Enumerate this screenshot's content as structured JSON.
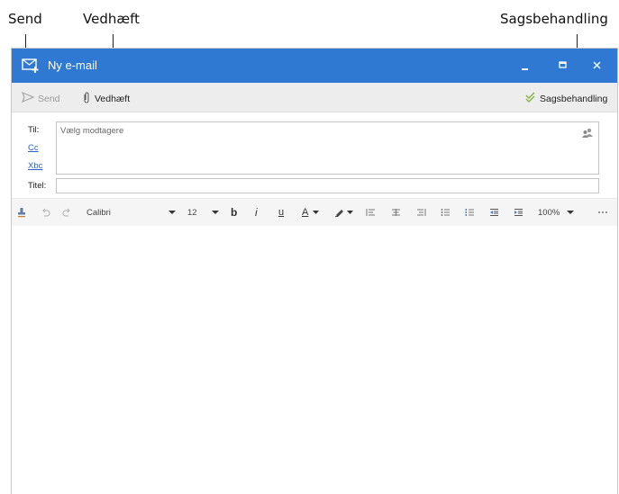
{
  "callouts": {
    "send": "Send",
    "attach": "Vedhæft",
    "case": "Sagsbehandling"
  },
  "window": {
    "title": "Ny e-mail",
    "accent_color": "#2f79d3",
    "controls": [
      "minimize-icon",
      "maximize-icon",
      "close-icon"
    ]
  },
  "toolbar": {
    "send_label": "Send",
    "attach_label": "Vedhæft",
    "case_label": "Sagsbehandling"
  },
  "headers": {
    "to_label": "Til:",
    "cc_label": "Cc",
    "bcc_label": "Xbc",
    "subject_label": "Titel:",
    "to_placeholder": "Vælg modtagere",
    "subject_value": ""
  },
  "format": {
    "font_name": "Calibri",
    "font_size": "12",
    "bold": "b",
    "italic": "i",
    "underline": "u",
    "font_color": "A",
    "zoom": "100%"
  }
}
